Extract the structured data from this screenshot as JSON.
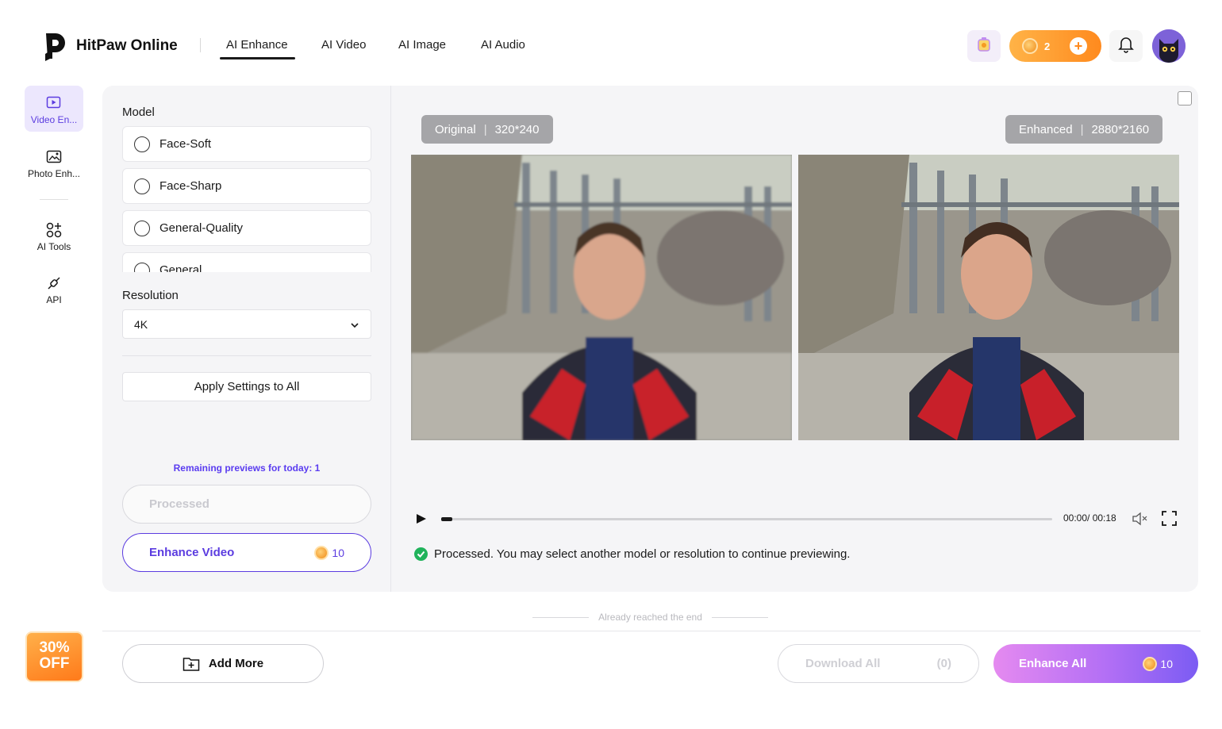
{
  "header": {
    "brand": "HitPaw Online",
    "nav": [
      "AI Enhance",
      "AI Video",
      "AI Image",
      "AI Audio"
    ],
    "credits": "2",
    "icons": [
      "gift-icon",
      "coin-icon",
      "plus-icon",
      "bell-icon",
      "avatar-image"
    ]
  },
  "sidebar": {
    "items": [
      {
        "label": "Video En...",
        "icon": "video-hd-icon"
      },
      {
        "label": "Photo Enh...",
        "icon": "photo-hd-icon"
      },
      {
        "label": "AI Tools",
        "icon": "tools-grid-icon"
      },
      {
        "label": "API",
        "icon": "plug-icon"
      }
    ]
  },
  "settings": {
    "model_label": "Model",
    "models": [
      "Face-Soft",
      "Face-Sharp",
      "General-Quality",
      "General"
    ],
    "resolution_label": "Resolution",
    "resolution_value": "4K",
    "apply_label": "Apply Settings to All",
    "remaining": "Remaining previews for today: 1",
    "processed_label": "Processed",
    "enhance_label": "Enhance Video",
    "enhance_cost": "10"
  },
  "preview": {
    "original_label": "Original",
    "original_size": "320*240",
    "enhanced_label": "Enhanced",
    "enhanced_size": "2880*2160",
    "time": "00:00/ 00:18",
    "progress": 0.0,
    "status": "Processed. You may select another model or resolution to continue previewing."
  },
  "footer": {
    "end_note": "Already reached the end",
    "promo_line1": "30%",
    "promo_line2": "OFF",
    "add_more": "Add More",
    "download_all": "Download All",
    "download_count": "(0)",
    "enhance_all": "Enhance All",
    "enhance_all_cost": "10"
  },
  "colors": {
    "accent": "#5b3ce0",
    "orange": "#ff8a1e",
    "success": "#20b35b"
  }
}
